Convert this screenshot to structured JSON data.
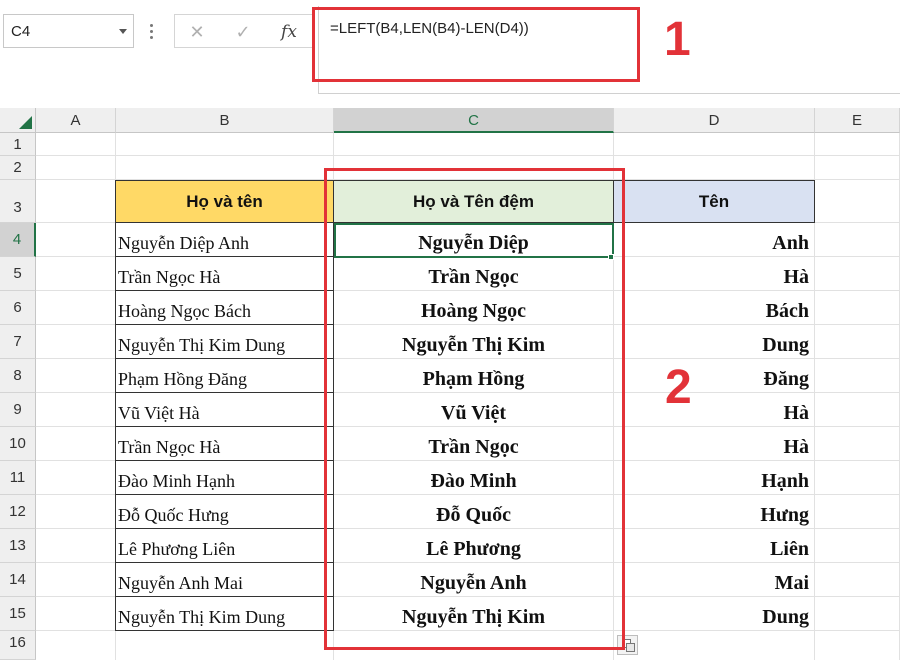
{
  "formula_bar": {
    "name_box": "C4",
    "cancel_icon": "✕",
    "enter_icon": "✓",
    "fx_icon": "fx",
    "formula": "=LEFT(B4,LEN(B4)-LEN(D4))"
  },
  "columns": [
    "A",
    "B",
    "C",
    "D",
    "E"
  ],
  "rows": [
    "1",
    "2",
    "3",
    "4",
    "5",
    "6",
    "7",
    "8",
    "9",
    "10",
    "11",
    "12",
    "13",
    "14",
    "15",
    "16"
  ],
  "table": {
    "headers": {
      "full_name": "Họ và tên",
      "last_middle": "Họ và Tên đệm",
      "first": "Tên"
    },
    "header_colors": {
      "full_name": "#ffd966",
      "last_middle": "#e2efda",
      "first": "#d9e1f2"
    },
    "data": [
      {
        "full": "Nguyễn Diệp Anh",
        "ho": "Nguyễn Diệp",
        "ten": "Anh"
      },
      {
        "full": "Trần Ngọc Hà",
        "ho": "Trần Ngọc",
        "ten": "Hà"
      },
      {
        "full": "Hoàng Ngọc Bách",
        "ho": "Hoàng Ngọc",
        "ten": "Bách"
      },
      {
        "full": "Nguyễn Thị Kim Dung",
        "ho": "Nguyễn Thị Kim",
        "ten": "Dung"
      },
      {
        "full": "Phạm Hồng Đăng",
        "ho": "Phạm Hồng",
        "ten": "Đăng"
      },
      {
        "full": "Vũ Việt Hà",
        "ho": "Vũ Việt",
        "ten": "Hà"
      },
      {
        "full": "Trần Ngọc Hà",
        "ho": "Trần Ngọc",
        "ten": "Hà"
      },
      {
        "full": "Đào Minh Hạnh",
        "ho": "Đào Minh",
        "ten": "Hạnh"
      },
      {
        "full": "Đỗ Quốc Hưng",
        "ho": "Đỗ Quốc",
        "ten": "Hưng"
      },
      {
        "full": "Lê Phương Liên",
        "ho": "Lê Phương",
        "ten": "Liên"
      },
      {
        "full": "Nguyễn Anh Mai",
        "ho": "Nguyễn Anh",
        "ten": "Mai"
      },
      {
        "full": "Nguyễn Thị Kim Dung",
        "ho": "Nguyễn Thị Kim",
        "ten": "Dung"
      }
    ]
  },
  "annotations": {
    "label_1": "1",
    "label_2": "2",
    "color": "#e23238"
  },
  "theme": {
    "accent": "#217346"
  }
}
